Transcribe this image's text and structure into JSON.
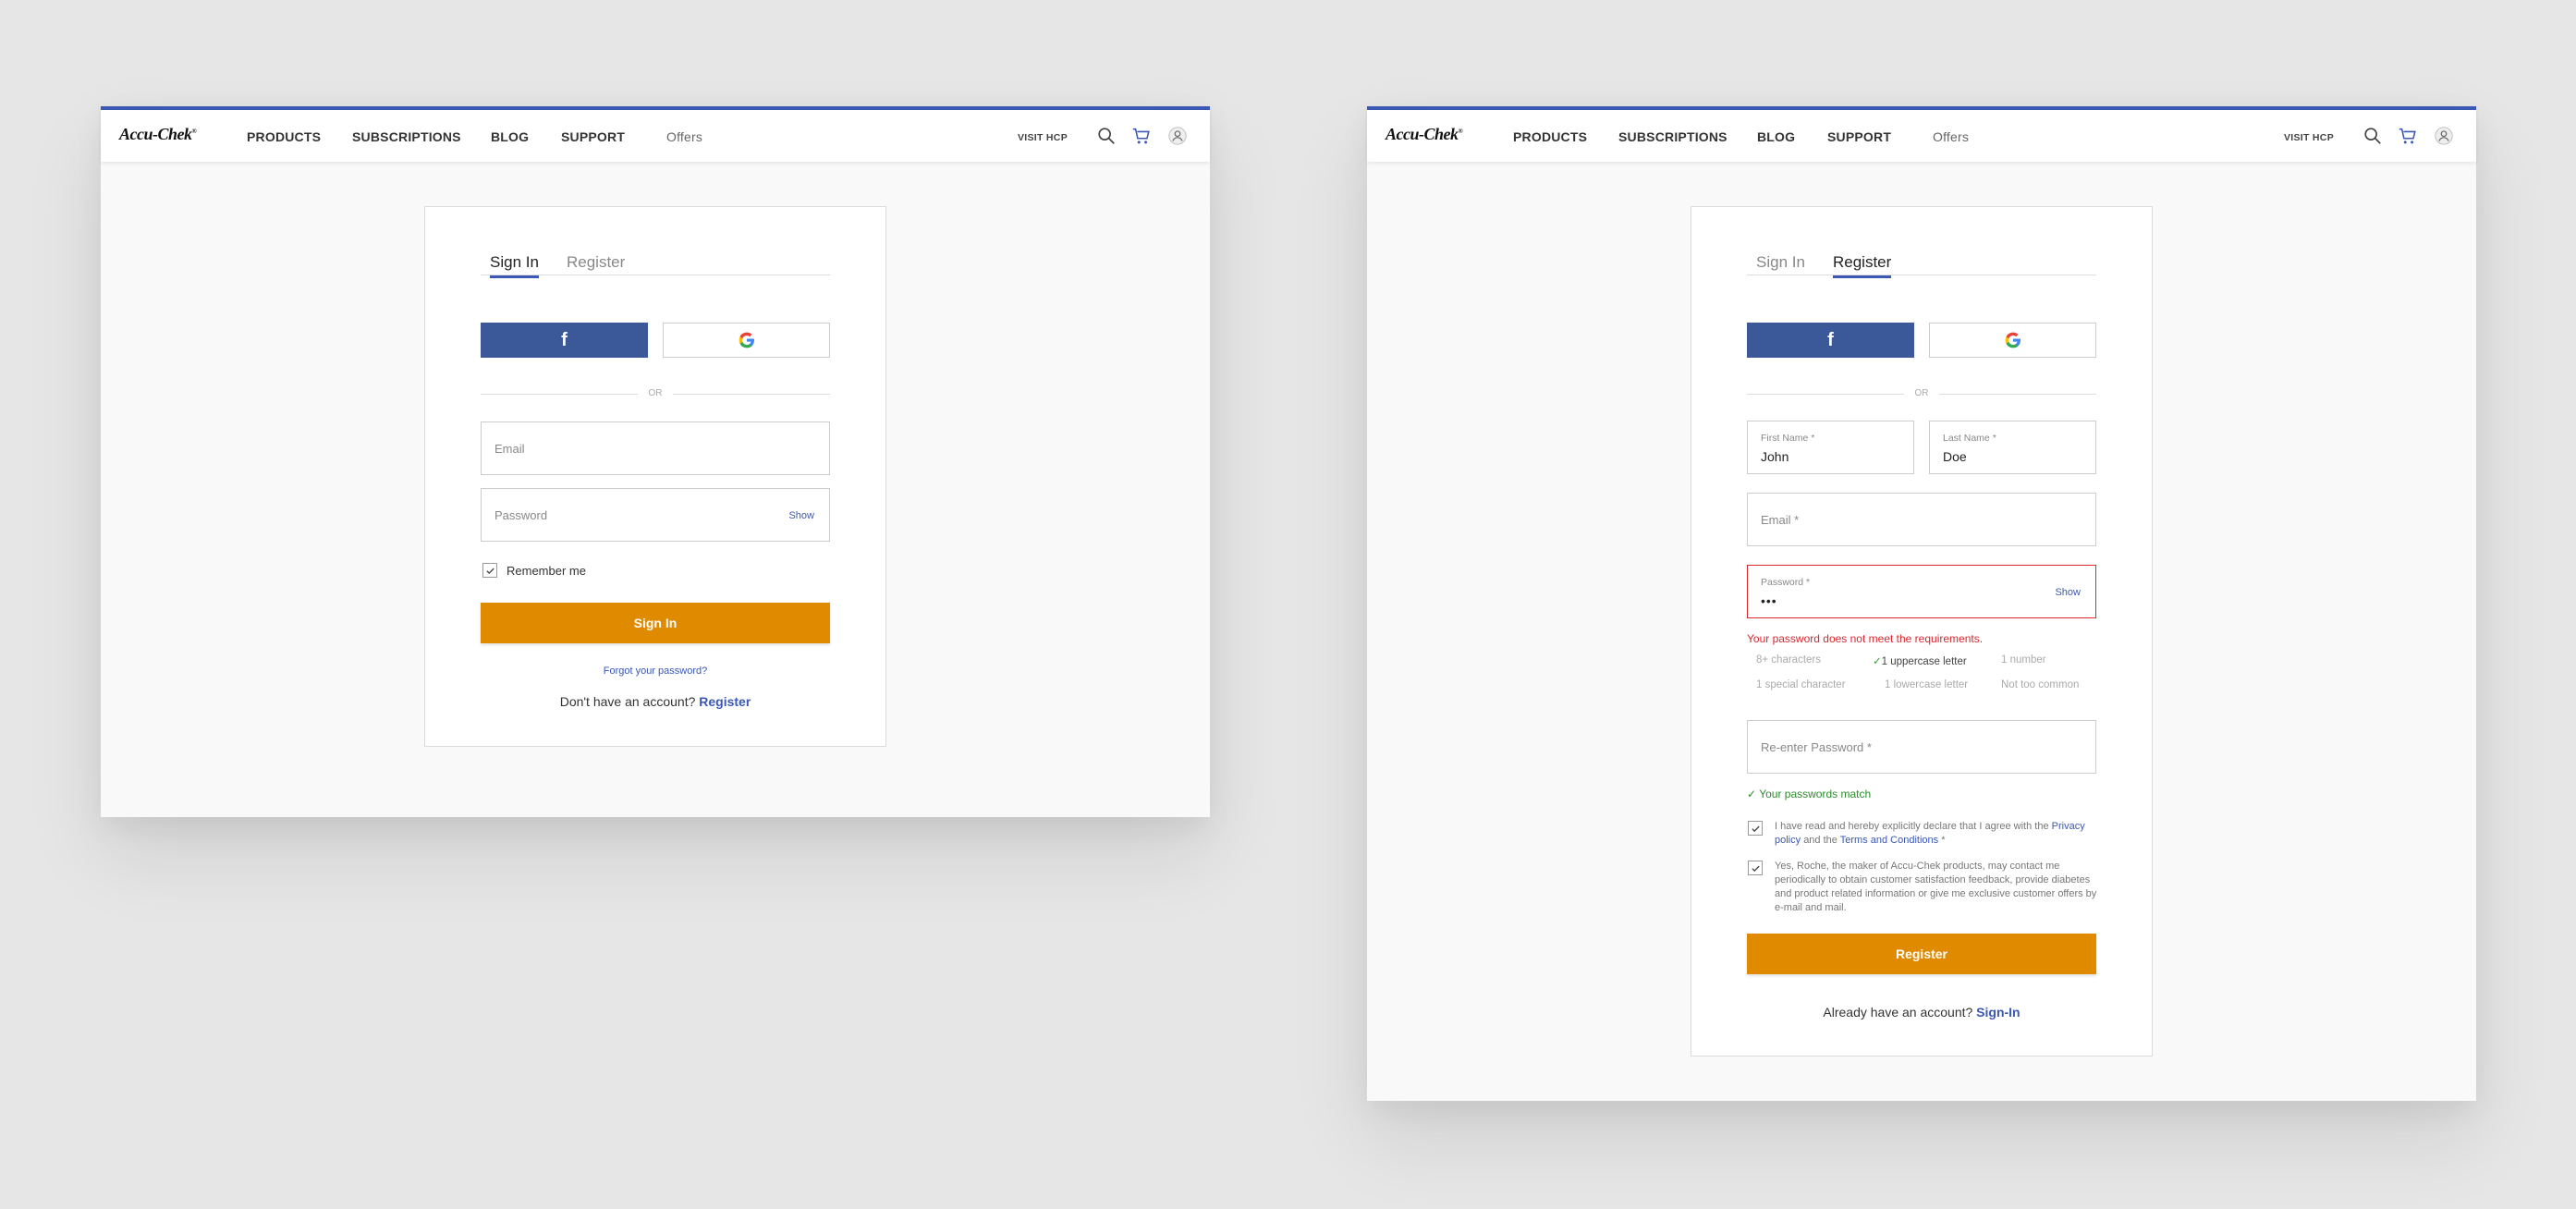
{
  "header": {
    "logo": "Accu-Chek",
    "logo_mark": "®",
    "nav": [
      "PRODUCTS",
      "SUBSCRIPTIONS",
      "BLOG",
      "SUPPORT",
      "Offers"
    ],
    "visit_hcp": "VISIT HCP"
  },
  "icons": {
    "search": "search-icon",
    "cart": "cart-icon",
    "account": "user-icon",
    "facebook": "facebook-icon",
    "google": "google-icon",
    "check": "check-icon"
  },
  "colors": {
    "accent": "#3b58b4",
    "primary_button": "#e08a00",
    "facebook": "#3b5998",
    "error": "#d9272e",
    "success": "#2e8b2e"
  },
  "signin": {
    "tabs": [
      "Sign In",
      "Register"
    ],
    "active_tab": "Sign In",
    "facebook_glyph": "f",
    "or": "OR",
    "email_placeholder": "Email",
    "password_placeholder": "Password",
    "show": "Show",
    "remember": "Remember me",
    "submit": "Sign In",
    "forgot": "Forgot your password?",
    "no_account": "Don't have an account?",
    "register_link": "Register"
  },
  "register": {
    "tabs": [
      "Sign In",
      "Register"
    ],
    "active_tab": "Register",
    "facebook_glyph": "f",
    "or": "OR",
    "first_name_label": "First Name *",
    "first_name_value": "John",
    "last_name_label": "Last Name *",
    "last_name_value": "Doe",
    "email_placeholder": "Email *",
    "password_label": "Password *",
    "password_value": "•••",
    "show": "Show",
    "error": "Your password does not meet the requirements.",
    "requirements": [
      {
        "text": "8+ characters",
        "met": false
      },
      {
        "text": "1 uppercase letter",
        "met": true
      },
      {
        "text": "1 number",
        "met": false
      },
      {
        "text": "1 special character",
        "met": false
      },
      {
        "text": "1 lowercase letter",
        "met": false
      },
      {
        "text": "Not too common",
        "met": false
      }
    ],
    "tick": "✓",
    "reenter_placeholder": "Re-enter Password *",
    "match": "Your passwords match",
    "consent1_a": "I have read and hereby explicitly declare that I agree with the",
    "consent1_privacy": "Privacy policy",
    "consent1_and": "and the",
    "consent1_terms": "Terms and Conditions",
    "consent1_star": "*",
    "consent2": "Yes, Roche, the maker of Accu-Chek products, may contact me periodically to obtain customer satisfaction feedback, provide diabetes and product related information or give me exclusive customer offers by e-mail and mail.",
    "submit": "Register",
    "have_account": "Already have an account?",
    "signin_link": "Sign-In"
  }
}
